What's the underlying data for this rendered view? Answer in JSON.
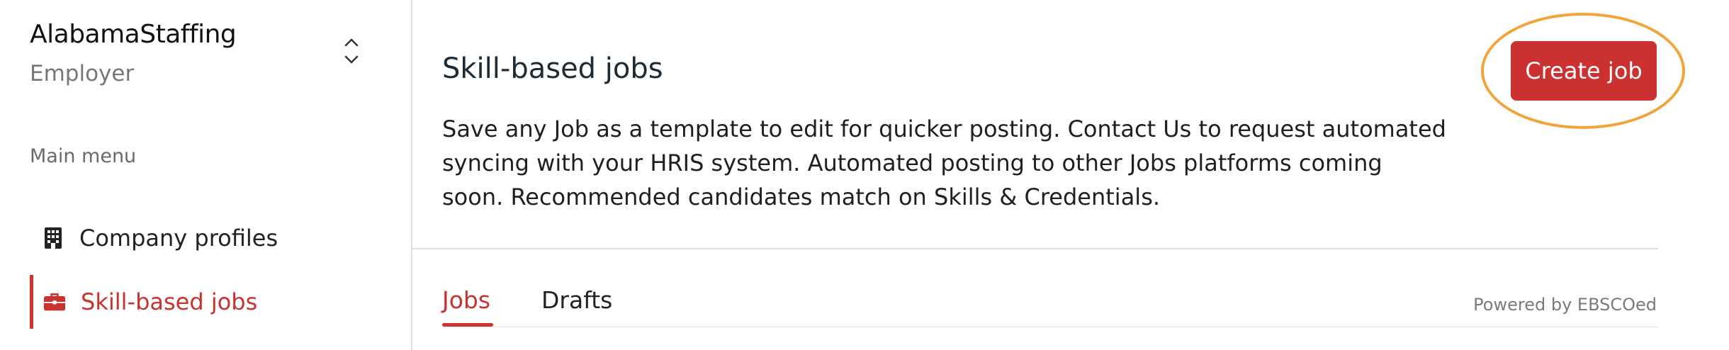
{
  "sidebar": {
    "org_name": "AlabamaStaffing",
    "org_role": "Employer",
    "menu_heading": "Main menu",
    "items": [
      {
        "label": "Company profiles",
        "icon": "building-icon",
        "active": false
      },
      {
        "label": "Skill-based jobs",
        "icon": "briefcase-icon",
        "active": true
      }
    ]
  },
  "main": {
    "title": "Skill-based jobs",
    "description": "Save any Job as a template to edit for quicker posting. Contact Us to request automated syncing with your HRIS system. Automated posting to other Jobs platforms coming soon. Recommended candidates match on Skills & Credentials.",
    "create_button_label": "Create job",
    "tabs": [
      {
        "label": "Jobs",
        "active": true
      },
      {
        "label": "Drafts",
        "active": false
      }
    ],
    "powered_by": "Powered by EBSCOed"
  },
  "colors": {
    "accent": "#cc3131",
    "highlight": "#f0a43a",
    "divider": "#dcdcdc"
  }
}
